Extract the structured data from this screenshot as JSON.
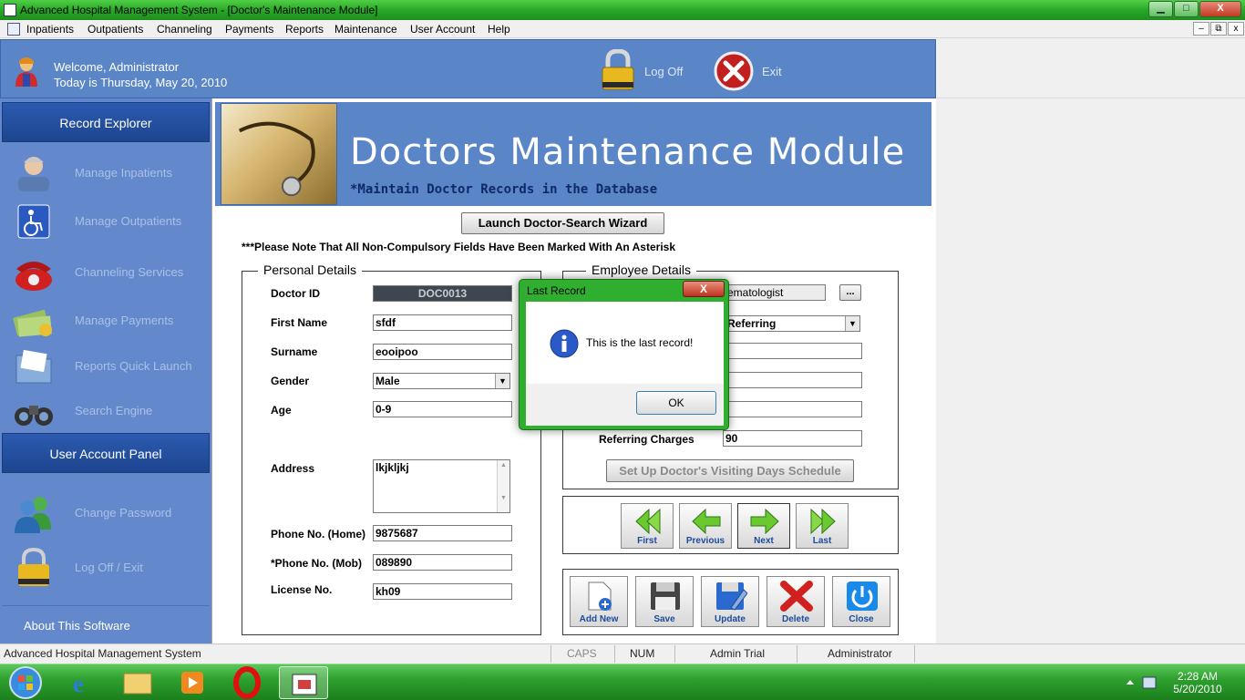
{
  "window": {
    "title": "Advanced Hospital Management System - [Doctor's Maintenance Module]",
    "controls": {
      "minimize": "▁",
      "maximize": "□",
      "close": "X"
    }
  },
  "menu": {
    "items": [
      "Inpatients",
      "Outpatients",
      "Channeling",
      "Payments",
      "Reports",
      "Maintenance",
      "User Account",
      "Help"
    ],
    "mdi": {
      "minimize": "–",
      "restore": "⧉",
      "close": "x"
    }
  },
  "header": {
    "welcome": "Welcome, Administrator",
    "today": "Today is Thursday, May 20, 2010",
    "logoff": "Log Off",
    "exit": "Exit"
  },
  "sidebar": {
    "record_explorer": "Record Explorer",
    "items": [
      {
        "label": "Manage Inpatients",
        "icon": "nurse-icon"
      },
      {
        "label": "Manage Outpatients",
        "icon": "wheelchair-icon"
      },
      {
        "label": "Channeling Services",
        "icon": "telephone-icon"
      },
      {
        "label": "Manage Payments",
        "icon": "money-icon"
      },
      {
        "label": "Reports Quick Launch",
        "icon": "folder-icon"
      },
      {
        "label": "Search Engine",
        "icon": "binoculars-icon"
      }
    ],
    "user_account_panel": "User Account Panel",
    "user_items": [
      {
        "label": "Change Password",
        "icon": "users-icon"
      },
      {
        "label": "Log Off / Exit",
        "icon": "padlock-icon"
      }
    ],
    "about": "About This Software"
  },
  "banner": {
    "title": "Doctors Maintenance Module",
    "subtitle": "*Maintain Doctor Records in the Database"
  },
  "wizard_button": "Launch Doctor-Search Wizard",
  "note": "***Please Note That All Non-Compulsory Fields Have Been Marked With An Asterisk",
  "personal": {
    "legend": "Personal Details",
    "doctor_id_label": "Doctor ID",
    "doctor_id": "DOC0013",
    "first_name_label": "First Name",
    "first_name": "sfdf",
    "surname_label": "Surname",
    "surname": "eooipoo",
    "gender_label": "Gender",
    "gender": "Male",
    "age_label": "Age",
    "age": "0-9",
    "address_label": "Address",
    "address": "lkjkljkj",
    "phone_home_label": "Phone No. (Home)",
    "phone_home": "9875687",
    "phone_mob_label": "*Phone No. (Mob)",
    "phone_mob": "089890",
    "license_label": "License No.",
    "license": "kh09"
  },
  "employee": {
    "legend": "Employee Details",
    "specialization": "ematologist",
    "browse": "...",
    "type": "Referring",
    "referring_charges_label": "Referring Charges",
    "referring_charges": "90",
    "schedule_button": "Set Up Doctor's Visiting Days Schedule"
  },
  "nav": {
    "first": "First",
    "previous": "Previous",
    "next": "Next",
    "last": "Last"
  },
  "actions": {
    "add_new": "Add New",
    "save": "Save",
    "update": "Update",
    "delete": "Delete",
    "close": "Close"
  },
  "dialog": {
    "title": "Last Record",
    "close": "X",
    "message": "This is the last record!",
    "ok": "OK"
  },
  "statusbar": {
    "app": "Advanced Hospital Management System",
    "caps": "CAPS",
    "num": "NUM",
    "mode": "Admin Trial",
    "user": "Administrator"
  },
  "taskbar": {
    "time": "2:28 AM",
    "date": "5/20/2010"
  },
  "colors": {
    "header_blue": "#5a86c8",
    "sidebar_blue": "#6389cc",
    "title_green": "#2aa828",
    "nav_green": "#6cc830"
  }
}
